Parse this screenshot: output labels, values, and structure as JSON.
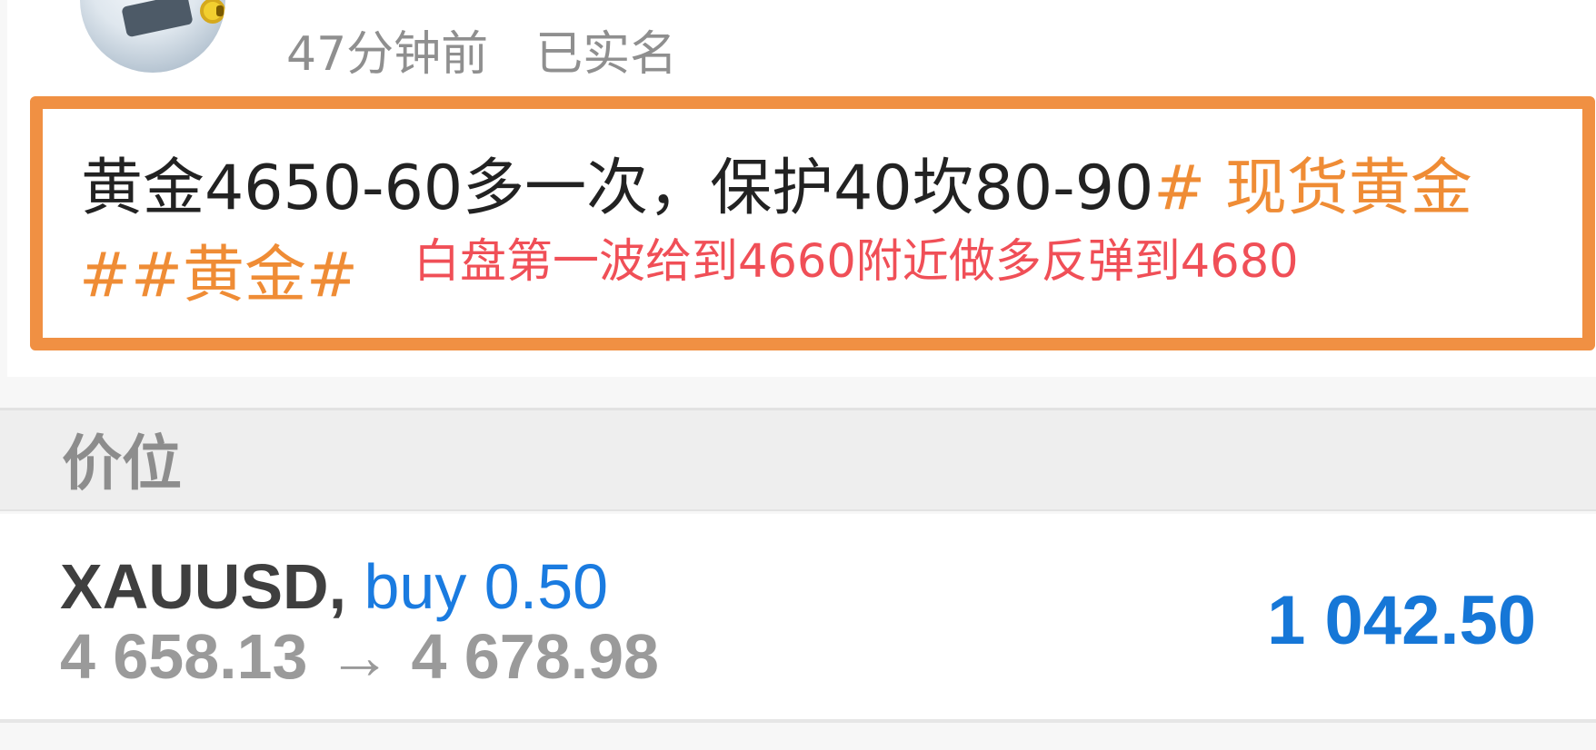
{
  "post": {
    "avatar_icon": "avatar-icon",
    "time_ago": "47分钟前",
    "verified": "已实名",
    "content_prefix": "黄金4650-60多一次，保护40坎80-90",
    "hashtag_1": "# 现货黄金",
    "hashtag_2": "##黄金#",
    "annotation": "白盘第一波给到4660附近做多反弹到4680",
    "box_color": "#f09043",
    "hashtag_color": "#ef8c35",
    "annotation_color": "#f04f57"
  },
  "section": {
    "title": "价位"
  },
  "trade": {
    "symbol": "XAUUSD,",
    "side_volume": "buy 0.50",
    "open_price": "4 658.13",
    "arrow": "→",
    "close_price": "4 678.98",
    "profit": "1 042.50",
    "profit_color": "#1677d7"
  }
}
